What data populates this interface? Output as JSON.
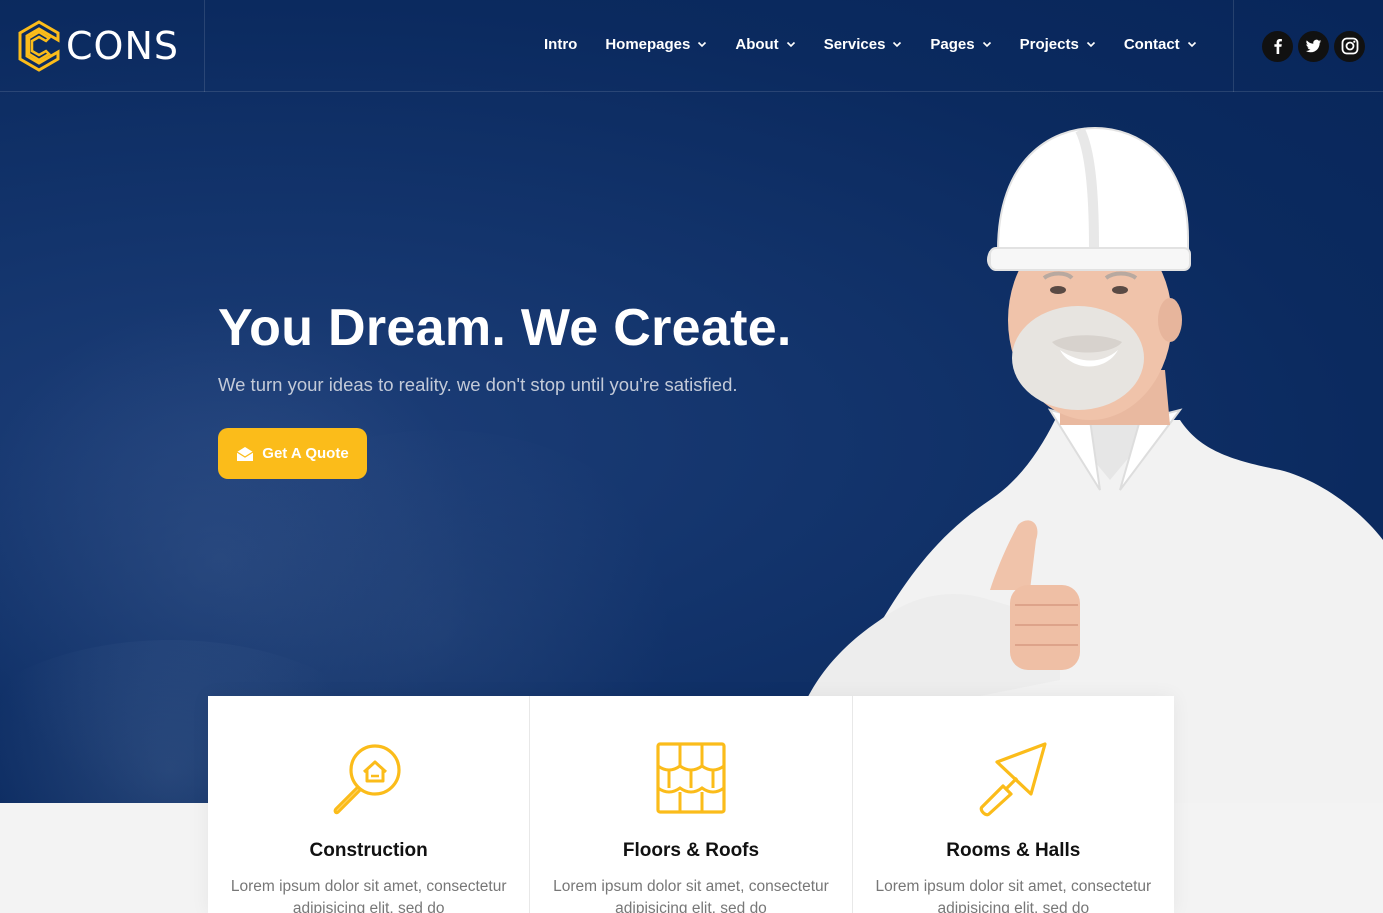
{
  "brand": {
    "name": "CONS",
    "accent": "#fbbc1a",
    "navy": "#0b2a5f"
  },
  "nav": {
    "items": [
      {
        "label": "Intro",
        "dropdown": false
      },
      {
        "label": "Homepages",
        "dropdown": true
      },
      {
        "label": "About",
        "dropdown": true
      },
      {
        "label": "Services",
        "dropdown": true
      },
      {
        "label": "Pages",
        "dropdown": true
      },
      {
        "label": "Projects",
        "dropdown": true
      },
      {
        "label": "Contact",
        "dropdown": true
      }
    ]
  },
  "social": [
    {
      "icon": "facebook-icon"
    },
    {
      "icon": "twitter-icon"
    },
    {
      "icon": "instagram-icon"
    }
  ],
  "hero": {
    "title": "You Dream. We Create.",
    "subtitle": "We turn your ideas to reality. we don't stop until you're satisfied.",
    "cta_label": "Get A Quote",
    "cta_icon": "envelope-open-icon"
  },
  "services": [
    {
      "title": "Construction",
      "text": "Lorem ipsum dolor sit amet, consectetur adipisicing elit, sed do",
      "icon": "house-search-icon"
    },
    {
      "title": "Floors & Roofs",
      "text": "Lorem ipsum dolor sit amet, consectetur adipisicing elit, sed do",
      "icon": "roof-tiles-icon"
    },
    {
      "title": "Rooms & Halls",
      "text": "Lorem ipsum dolor sit amet, consectetur adipisicing elit, sed do",
      "icon": "trowel-icon"
    }
  ]
}
